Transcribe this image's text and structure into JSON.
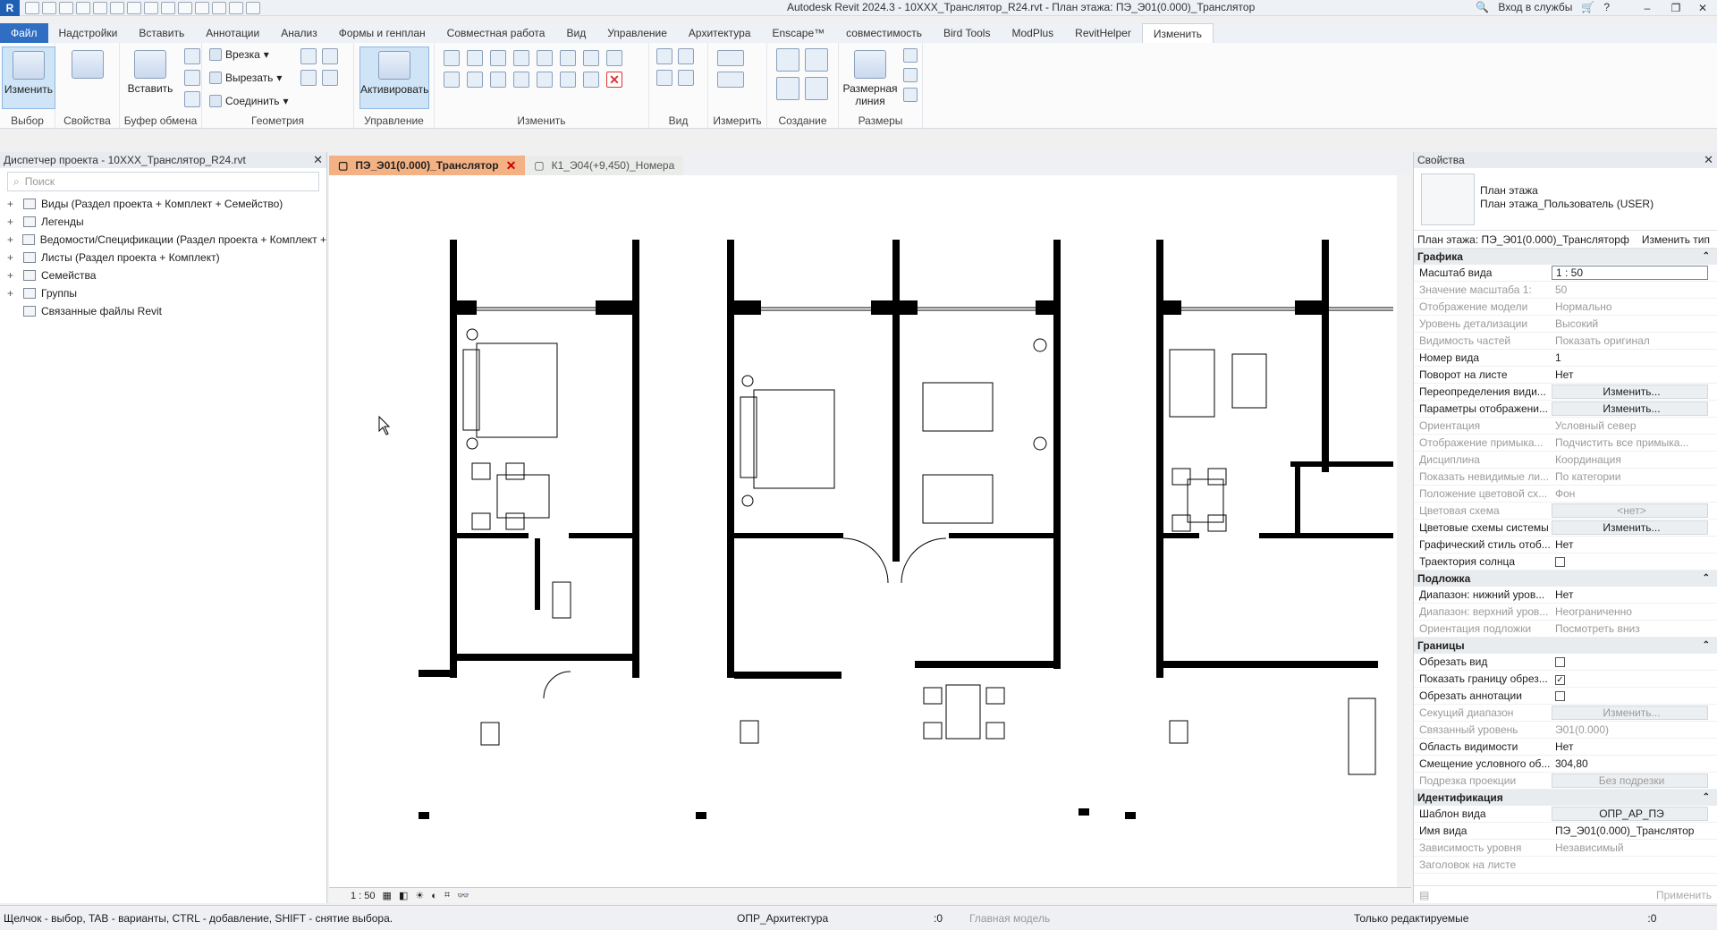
{
  "app": {
    "logo": "R",
    "title": "Autodesk Revit 2024.3 - 10XXX_Транслятор_R24.rvt - План этажа: ПЭ_Э01(0.000)_Транслятор",
    "signin": "Вход в службы",
    "min": "–",
    "max": "❐",
    "close": "✕"
  },
  "tabs": [
    "Файл",
    "Надстройки",
    "Вставить",
    "Аннотации",
    "Анализ",
    "Формы и генплан",
    "Совместная работа",
    "Вид",
    "Управление",
    "Архитектура",
    "Enscape™",
    "совместимость",
    "Bird Tools",
    "ModPlus",
    "RevitHelper",
    "Изменить"
  ],
  "ribbon": {
    "select": {
      "modify": "Изменить",
      "label": "Выбор"
    },
    "properties": {
      "label": "Свойства"
    },
    "clipboard": {
      "paste": "Вставить",
      "label": "Буфер обмена"
    },
    "geometry": {
      "cope": "Врезка",
      "cut": "Вырезать",
      "join": "Соединить",
      "label": "Геометрия"
    },
    "controls": {
      "activate": "Активировать",
      "label": "Управление"
    },
    "modify": {
      "label": "Изменить"
    },
    "view": {
      "label": "Вид"
    },
    "measure": {
      "label": "Измерить"
    },
    "create": {
      "label": "Создание"
    },
    "dimension": {
      "aligned": "Размерная линия",
      "label": "Размеры"
    }
  },
  "browser": {
    "title": "Диспетчер проекта - 10XXX_Транслятор_R24.rvt",
    "search_placeholder": "Поиск",
    "items": [
      {
        "label": "Виды (Раздел проекта + Комплект + Семейство)",
        "expand": "+"
      },
      {
        "label": "Легенды",
        "expand": "+"
      },
      {
        "label": "Ведомости/Спецификации (Раздел проекта + Комплект +",
        "expand": "+"
      },
      {
        "label": "Листы (Раздел проекта + Комплект)",
        "expand": "+"
      },
      {
        "label": "Семейства",
        "expand": "+"
      },
      {
        "label": "Группы",
        "expand": "+"
      },
      {
        "label": "Связанные файлы Revit",
        "expand": ""
      }
    ]
  },
  "view_tabs": [
    {
      "label": "ПЭ_Э01(0.000)_Транслятор",
      "close": "✕"
    },
    {
      "label": "К1_Э04(+9,450)_Номера"
    }
  ],
  "viewbar": {
    "scale": "1 : 50"
  },
  "properties": {
    "title": "Свойства",
    "type_family": "План этажа",
    "type_name": "План этажа_Пользователь (USER)",
    "selector": "План этажа: ПЭ_Э01(0.000)_Трансляторф",
    "edit_type": "Изменить тип",
    "groups": [
      {
        "name": "Графика",
        "rows": [
          {
            "k": "Масштаб вида",
            "v": "1 : 50",
            "style": "boxed"
          },
          {
            "k": "Значение масштаба    1:",
            "v": "50",
            "style": "dim"
          },
          {
            "k": "Отображение модели",
            "v": "Нормально",
            "style": "dim"
          },
          {
            "k": "Уровень детализации",
            "v": "Высокий",
            "style": "dim"
          },
          {
            "k": "Видимость частей",
            "v": "Показать оригинал",
            "style": "dim"
          },
          {
            "k": "Номер вида",
            "v": "1"
          },
          {
            "k": "Поворот на листе",
            "v": "Нет"
          },
          {
            "k": "Переопределения види...",
            "v": "Изменить...",
            "style": "btn"
          },
          {
            "k": "Параметры отображени...",
            "v": "Изменить...",
            "style": "btn"
          },
          {
            "k": "Ориентация",
            "v": "Условный север",
            "style": "dim"
          },
          {
            "k": "Отображение примыка...",
            "v": "Подчистить все примыка...",
            "style": "dim"
          },
          {
            "k": "Дисциплина",
            "v": "Координация",
            "style": "dim"
          },
          {
            "k": "Показать невидимые ли...",
            "v": "По категории",
            "style": "dim"
          },
          {
            "k": "Положение цветовой сх...",
            "v": "Фон",
            "style": "dim"
          },
          {
            "k": "Цветовая схема",
            "v": "<нет>",
            "style": "dimbtn"
          },
          {
            "k": "Цветовые схемы системы",
            "v": "Изменить...",
            "style": "btn"
          },
          {
            "k": "Графический стиль отоб...",
            "v": "Нет"
          },
          {
            "k": "Траектория солнца",
            "v": "",
            "style": "check",
            "checked": false
          }
        ]
      },
      {
        "name": "Подложка",
        "rows": [
          {
            "k": "Диапазон: нижний уров...",
            "v": "Нет"
          },
          {
            "k": "Диапазон: верхний уров...",
            "v": "Неограниченно",
            "style": "dim"
          },
          {
            "k": "Ориентация подложки",
            "v": "Посмотреть вниз",
            "style": "dim"
          }
        ]
      },
      {
        "name": "Границы",
        "rows": [
          {
            "k": "Обрезать вид",
            "v": "",
            "style": "check",
            "checked": false
          },
          {
            "k": "Показать границу обрез...",
            "v": "",
            "style": "check",
            "checked": true
          },
          {
            "k": "Обрезать аннотации",
            "v": "",
            "style": "check",
            "checked": false
          },
          {
            "k": "Секущий диапазон",
            "v": "Изменить...",
            "style": "dimbtn"
          },
          {
            "k": "Связанный уровень",
            "v": "Э01(0.000)",
            "style": "dim"
          },
          {
            "k": "Область видимости",
            "v": "Нет"
          },
          {
            "k": "Смещение условного об...",
            "v": "304,80"
          },
          {
            "k": "Подрезка проекции",
            "v": "Без подрезки",
            "style": "dimbtn"
          }
        ]
      },
      {
        "name": "Идентификация",
        "rows": [
          {
            "k": "Шаблон вида",
            "v": "ОПР_АР_ПЭ",
            "style": "btn"
          },
          {
            "k": "Имя вида",
            "v": "ПЭ_Э01(0.000)_Транслятор"
          },
          {
            "k": "Зависимость уровня",
            "v": "Независимый",
            "style": "dim"
          },
          {
            "k": "Заголовок на листе",
            "v": "",
            "style": "dim"
          }
        ]
      }
    ],
    "apply": "Применить"
  },
  "status": {
    "hint": "Щелчок - выбор, TAB - варианты, CTRL - добавление, SHIFT - снятие выбора.",
    "workset": "ОПР_Архитектура",
    "count": ":0",
    "model": "Главная модель",
    "editable_only": "Только редактируемые",
    "filter": ":0"
  }
}
